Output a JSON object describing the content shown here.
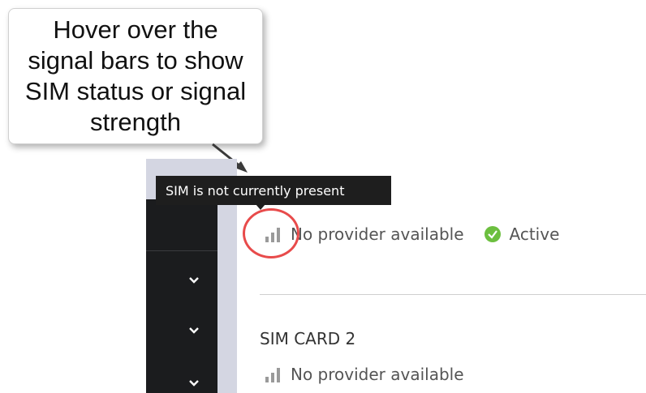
{
  "callout": {
    "text": "Hover over the signal bars to show SIM status or signal strength"
  },
  "tooltip": {
    "text": "SIM is not currently present"
  },
  "sim1": {
    "provider": "No provider available",
    "status": "Active",
    "status_color": "#6cbf3f",
    "signal_icon": "signal-bars-icon"
  },
  "sim2": {
    "label": "SIM CARD 2",
    "provider": "No provider available",
    "signal_icon": "signal-bars-icon"
  },
  "sidebar": {
    "items": [
      {
        "icon": "chevron-down-icon"
      },
      {
        "icon": "chevron-down-icon"
      },
      {
        "icon": "chevron-down-icon"
      }
    ]
  },
  "colors": {
    "highlight": "#e84b4b",
    "sidebar_bg": "#1b1c1e",
    "tooltip_bg": "#1e1e1e",
    "signal_bars": "#9a9a9a"
  }
}
